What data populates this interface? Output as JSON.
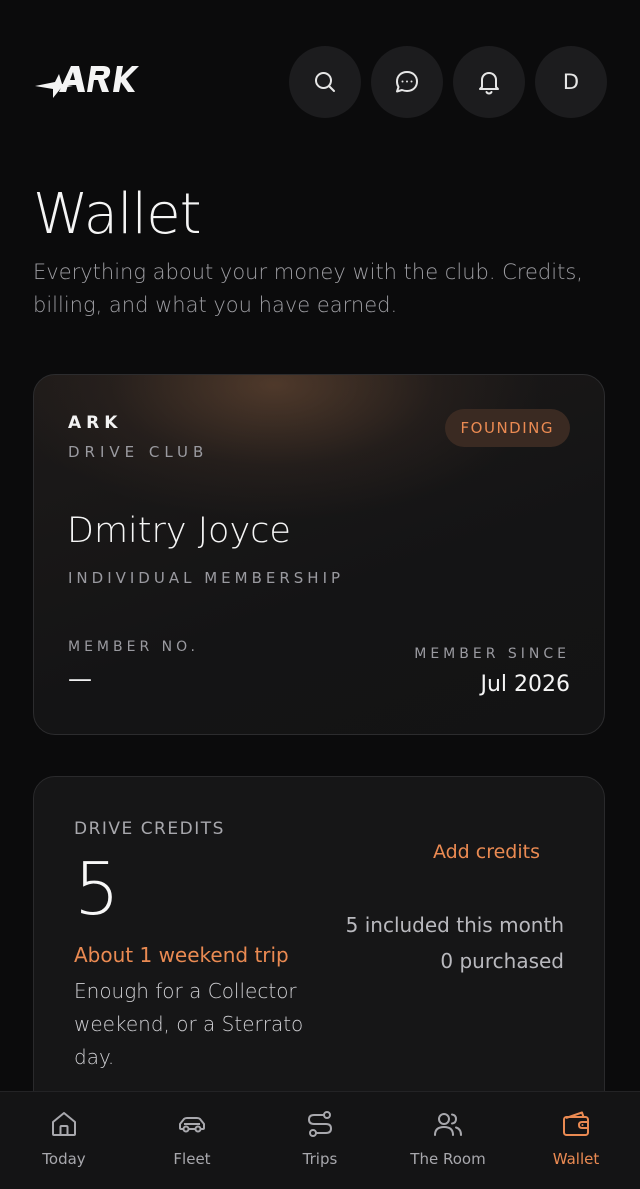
{
  "header": {
    "logo_text": "ARK",
    "avatar_initial": "D",
    "icons": [
      "search-icon",
      "chat-icon",
      "bell-icon"
    ]
  },
  "page": {
    "title": "Wallet",
    "subtitle": "Everything about your money with the club. Credits, billing, and what you have earned."
  },
  "membership_card": {
    "brand": "ARK",
    "brand_sub": "DRIVE CLUB",
    "badge": "FOUNDING",
    "member_name": "Dmitry Joyce",
    "membership_type": "INDIVIDUAL MEMBERSHIP",
    "member_no_label": "MEMBER NO.",
    "member_no_value": "—",
    "member_since_label": "MEMBER SINCE",
    "member_since_value": "Jul 2026"
  },
  "credits_card": {
    "label": "DRIVE CREDITS",
    "value": "5",
    "estimate": "About 1 weekend trip",
    "description": "Enough for a Collector weekend, or a Sterrato day.",
    "add_label": "Add credits",
    "included": "5 included this month",
    "purchased": "0 purchased"
  },
  "nav": {
    "items": [
      {
        "label": "Today",
        "icon": "home-icon"
      },
      {
        "label": "Fleet",
        "icon": "car-icon"
      },
      {
        "label": "Trips",
        "icon": "route-icon"
      },
      {
        "label": "The Room",
        "icon": "users-icon"
      },
      {
        "label": "Wallet",
        "icon": "wallet-icon",
        "active": true
      }
    ]
  },
  "colors": {
    "accent": "#ea8a52",
    "background": "#0b0b0c",
    "surface": "#161617"
  }
}
